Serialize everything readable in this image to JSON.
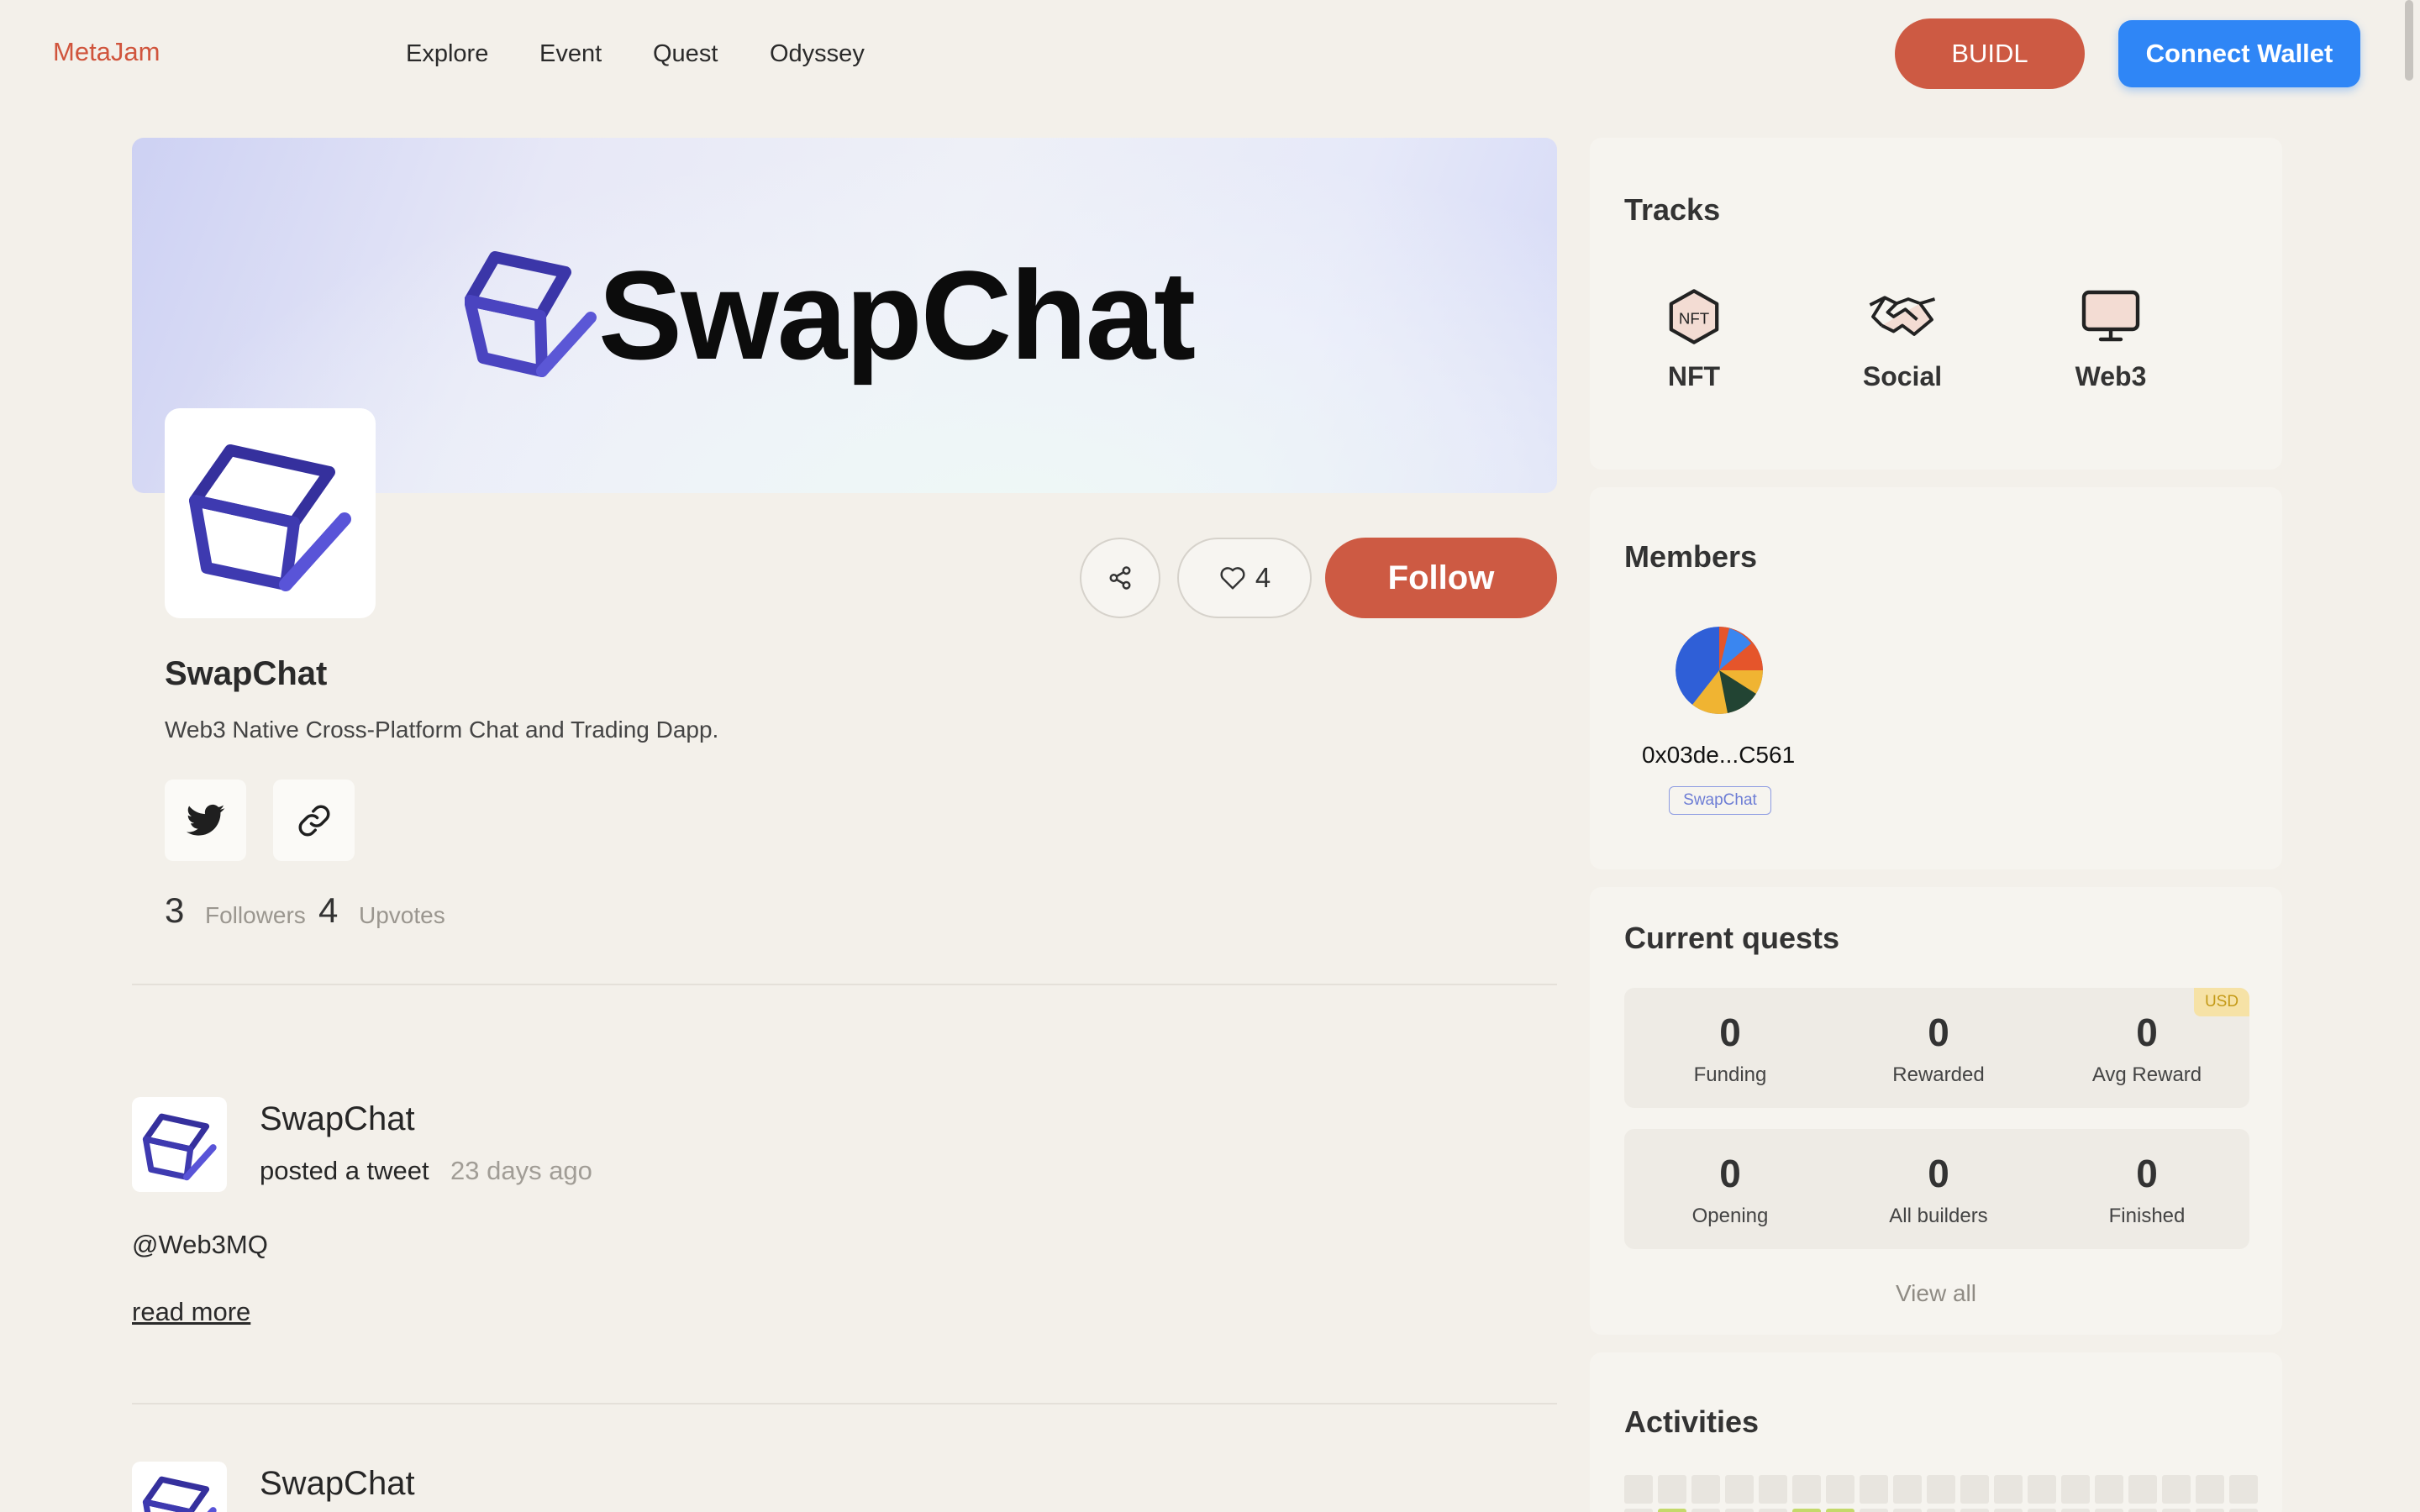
{
  "nav": {
    "brand": "MetaJam",
    "links": [
      "Explore",
      "Event",
      "Quest",
      "Odyssey"
    ],
    "buidl_label": "BUIDL",
    "connect_label": "Connect Wallet"
  },
  "banner": {
    "title": "SwapChat"
  },
  "actions": {
    "like_count": "4",
    "follow_label": "Follow"
  },
  "project": {
    "name": "SwapChat",
    "description": "Web3 Native Cross-Platform Chat and Trading Dapp.",
    "followers_count": "3",
    "followers_label": "Followers",
    "upvotes_count": "4",
    "upvotes_label": "Upvotes"
  },
  "feed": [
    {
      "name": "SwapChat",
      "action": "posted a tweet",
      "time": "23 days ago",
      "text": "@Web3MQ",
      "read_more": "read more"
    },
    {
      "name": "SwapChat"
    }
  ],
  "tracks": {
    "title": "Tracks",
    "items": [
      {
        "label": "NFT",
        "icon": "nft-icon"
      },
      {
        "label": "Social",
        "icon": "handshake-icon"
      },
      {
        "label": "Web3",
        "icon": "monitor-icon"
      }
    ]
  },
  "members": {
    "title": "Members",
    "items": [
      {
        "address": "0x03de...C561",
        "tag": "SwapChat"
      }
    ]
  },
  "quests": {
    "title": "Current quests",
    "currency_badge": "USD",
    "stats": [
      {
        "value": "0",
        "label": "Funding"
      },
      {
        "value": "0",
        "label": "Rewarded"
      },
      {
        "value": "0",
        "label": "Avg Reward"
      },
      {
        "value": "0",
        "label": "Opening"
      },
      {
        "value": "0",
        "label": "All builders"
      },
      {
        "value": "0",
        "label": "Finished"
      }
    ],
    "view_all": "View all"
  },
  "activities": {
    "title": "Activities"
  },
  "colors": {
    "accent": "#cd5a43",
    "wallet_blue": "#2f86f6",
    "background": "#f3f0ea",
    "cube_purple": "#3b36a8"
  }
}
